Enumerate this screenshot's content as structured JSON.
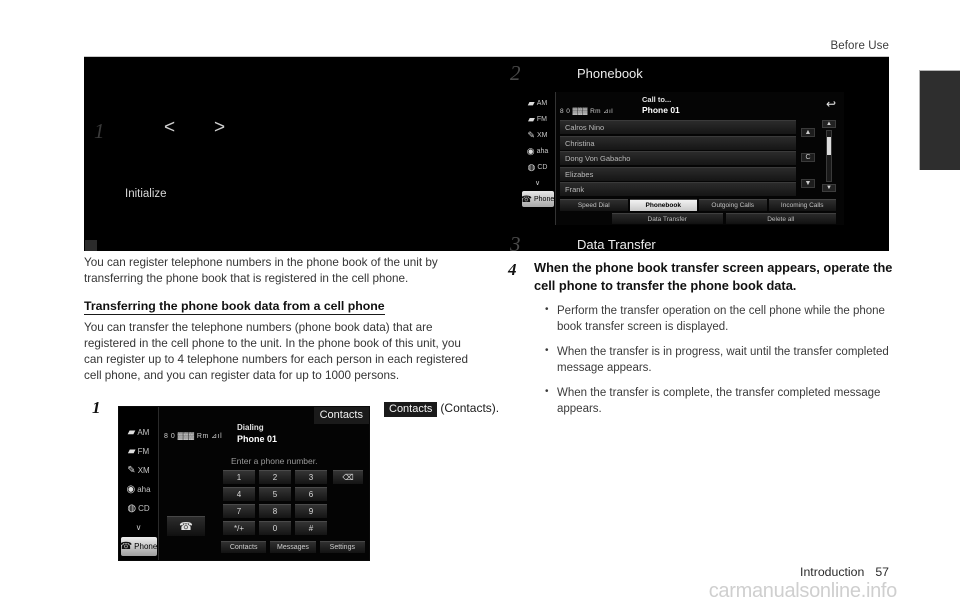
{
  "header": {
    "section": "Before Use"
  },
  "figure_band": {
    "left_fragment": {
      "step_number": "1",
      "prev_arrow": "<",
      "next_arrow": ">",
      "initialize_label": "Initialize"
    },
    "step2": {
      "number": "2",
      "label": "Phonebook"
    },
    "step3": {
      "number": "3",
      "label": "Data Transfer"
    }
  },
  "head_unit_phonebook": {
    "sidebar": [
      {
        "icon": "am-radio-icon",
        "label": "AM"
      },
      {
        "icon": "fm-radio-icon",
        "label": "FM"
      },
      {
        "icon": "xm-radio-icon",
        "label": "XM"
      },
      {
        "icon": "aha-icon",
        "label": "aha"
      },
      {
        "icon": "cd-disc-icon",
        "label": "CD"
      },
      {
        "icon": "chevron-down-icon",
        "label": "∨"
      },
      {
        "icon": "phone-icon",
        "label": "Phone"
      }
    ],
    "status_bar": "8 0 ▓▓▓ Rm ⊿ıl",
    "call_to_label": "Call to...",
    "phone_label": "Phone 01",
    "back_icon": "back-arrow-icon",
    "contacts": [
      "Calros Nino",
      "Christina",
      "Dong Von Gabacho",
      "Elizabes",
      "Frank"
    ],
    "mid_controls": [
      "▲",
      "C",
      "▼"
    ],
    "scroll": {
      "up": "▲",
      "down": "▼"
    },
    "tabs": [
      {
        "label": "Speed Dial",
        "active": false
      },
      {
        "label": "Phonebook",
        "active": true
      },
      {
        "label": "Outgoing Calls",
        "active": false
      },
      {
        "label": "Incoming Calls",
        "active": false
      }
    ],
    "tabs_row2": [
      "Data Transfer",
      "Delete all"
    ]
  },
  "left_column": {
    "intro_paragraph": "You can register telephone numbers in the phone book of the unit by transferring the phone book that is registered in the cell phone.",
    "subheading": "Transferring the phone book data from a cell phone",
    "body_paragraph": "You can transfer the telephone numbers (phone book data) that are registered in the cell phone to the unit. In the phone book of this unit, you can register up to 4 telephone numbers for each person in each registered cell phone, and you can register data for up to 1000 persons."
  },
  "step1": {
    "number": "1",
    "pill_label": "Contacts",
    "trailing_text": "(Contacts)."
  },
  "head_unit_dialer": {
    "contacts_pill": "Contacts",
    "sidebar": [
      {
        "icon": "am-radio-icon",
        "label": "AM"
      },
      {
        "icon": "fm-radio-icon",
        "label": "FM"
      },
      {
        "icon": "xm-radio-icon",
        "label": "XM"
      },
      {
        "icon": "aha-icon",
        "label": "aha"
      },
      {
        "icon": "cd-disc-icon",
        "label": "CD"
      },
      {
        "icon": "chevron-down-icon",
        "label": "∨"
      },
      {
        "icon": "phone-icon",
        "label": "Phone"
      }
    ],
    "status_bar": "8 0 ▓▓▓ Rm ⊿ıl",
    "dialing_label": "Dialing",
    "phone_label": "Phone 01",
    "prompt": "Enter a phone number.",
    "keys": [
      "1",
      "2",
      "3",
      "4",
      "5",
      "6",
      "7",
      "8",
      "9",
      "*/+",
      "0",
      "#"
    ],
    "delete_key": "⌫",
    "call_button_icon": "call-handset-icon",
    "bottom_buttons": [
      "Contacts",
      "Messages",
      "Settings"
    ]
  },
  "step4": {
    "number": "4",
    "title": "When the phone book transfer screen appears, operate the cell phone to transfer the phone book data.",
    "bullets": [
      "Perform the transfer operation on the cell phone while the phone book transfer screen is displayed.",
      "When the transfer is in progress, wait until the transfer completed message appears.",
      "When the transfer is complete, the transfer completed message appears."
    ]
  },
  "footer": {
    "chapter": "Introduction",
    "page_number": "57",
    "watermark": "carmanualsonline.info"
  }
}
